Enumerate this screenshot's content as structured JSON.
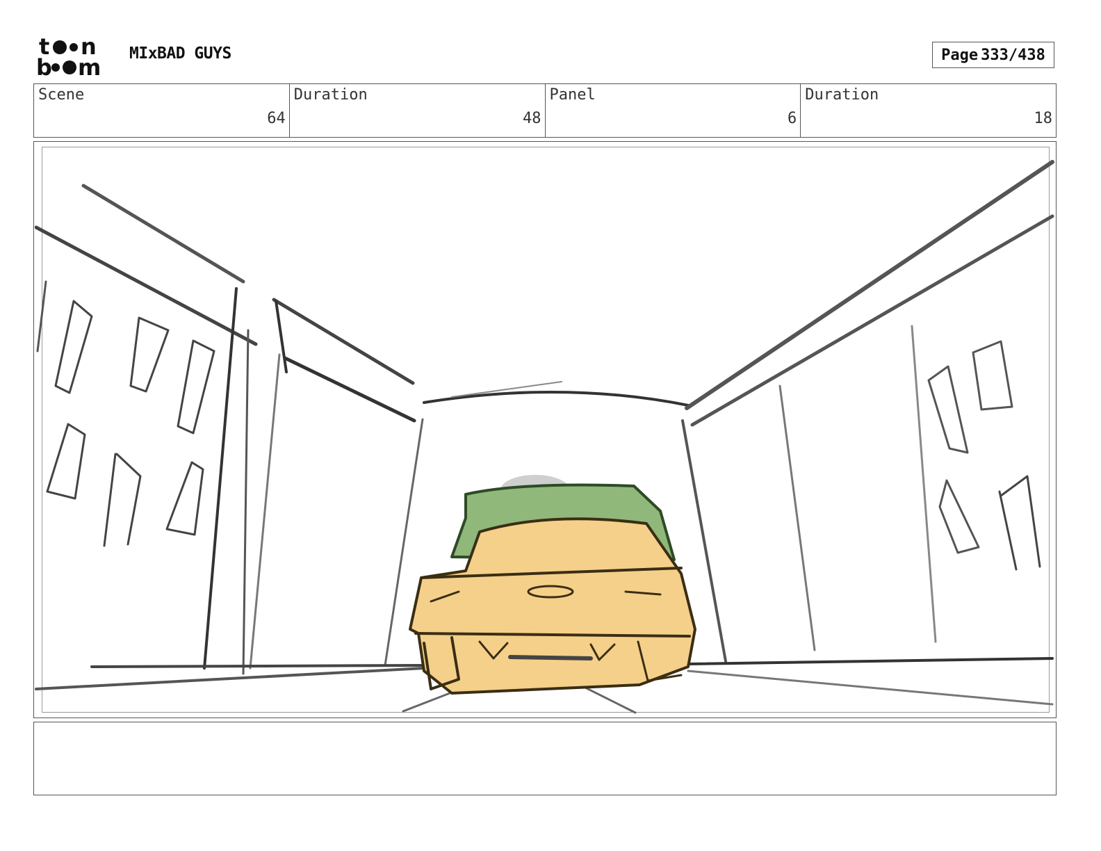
{
  "header": {
    "logo_text_top": "toon",
    "logo_text_bottom": "boom",
    "project_title": "MIxBAD GUYS",
    "page_label": "Page",
    "page_number": "333/438"
  },
  "info": {
    "scene_label": "Scene",
    "scene_value": "64",
    "scene_duration_label": "Duration",
    "scene_duration_value": "48",
    "panel_label": "Panel",
    "panel_value": "6",
    "panel_duration_label": "Duration",
    "panel_duration_value": "18"
  },
  "panel": {
    "description_icons": [
      "street-sketch",
      "car-sketch"
    ],
    "colors": {
      "car_body": "#f5d08a",
      "car_roof": "#8fb87a",
      "line": "#333333"
    }
  },
  "notes": {
    "text": ""
  }
}
